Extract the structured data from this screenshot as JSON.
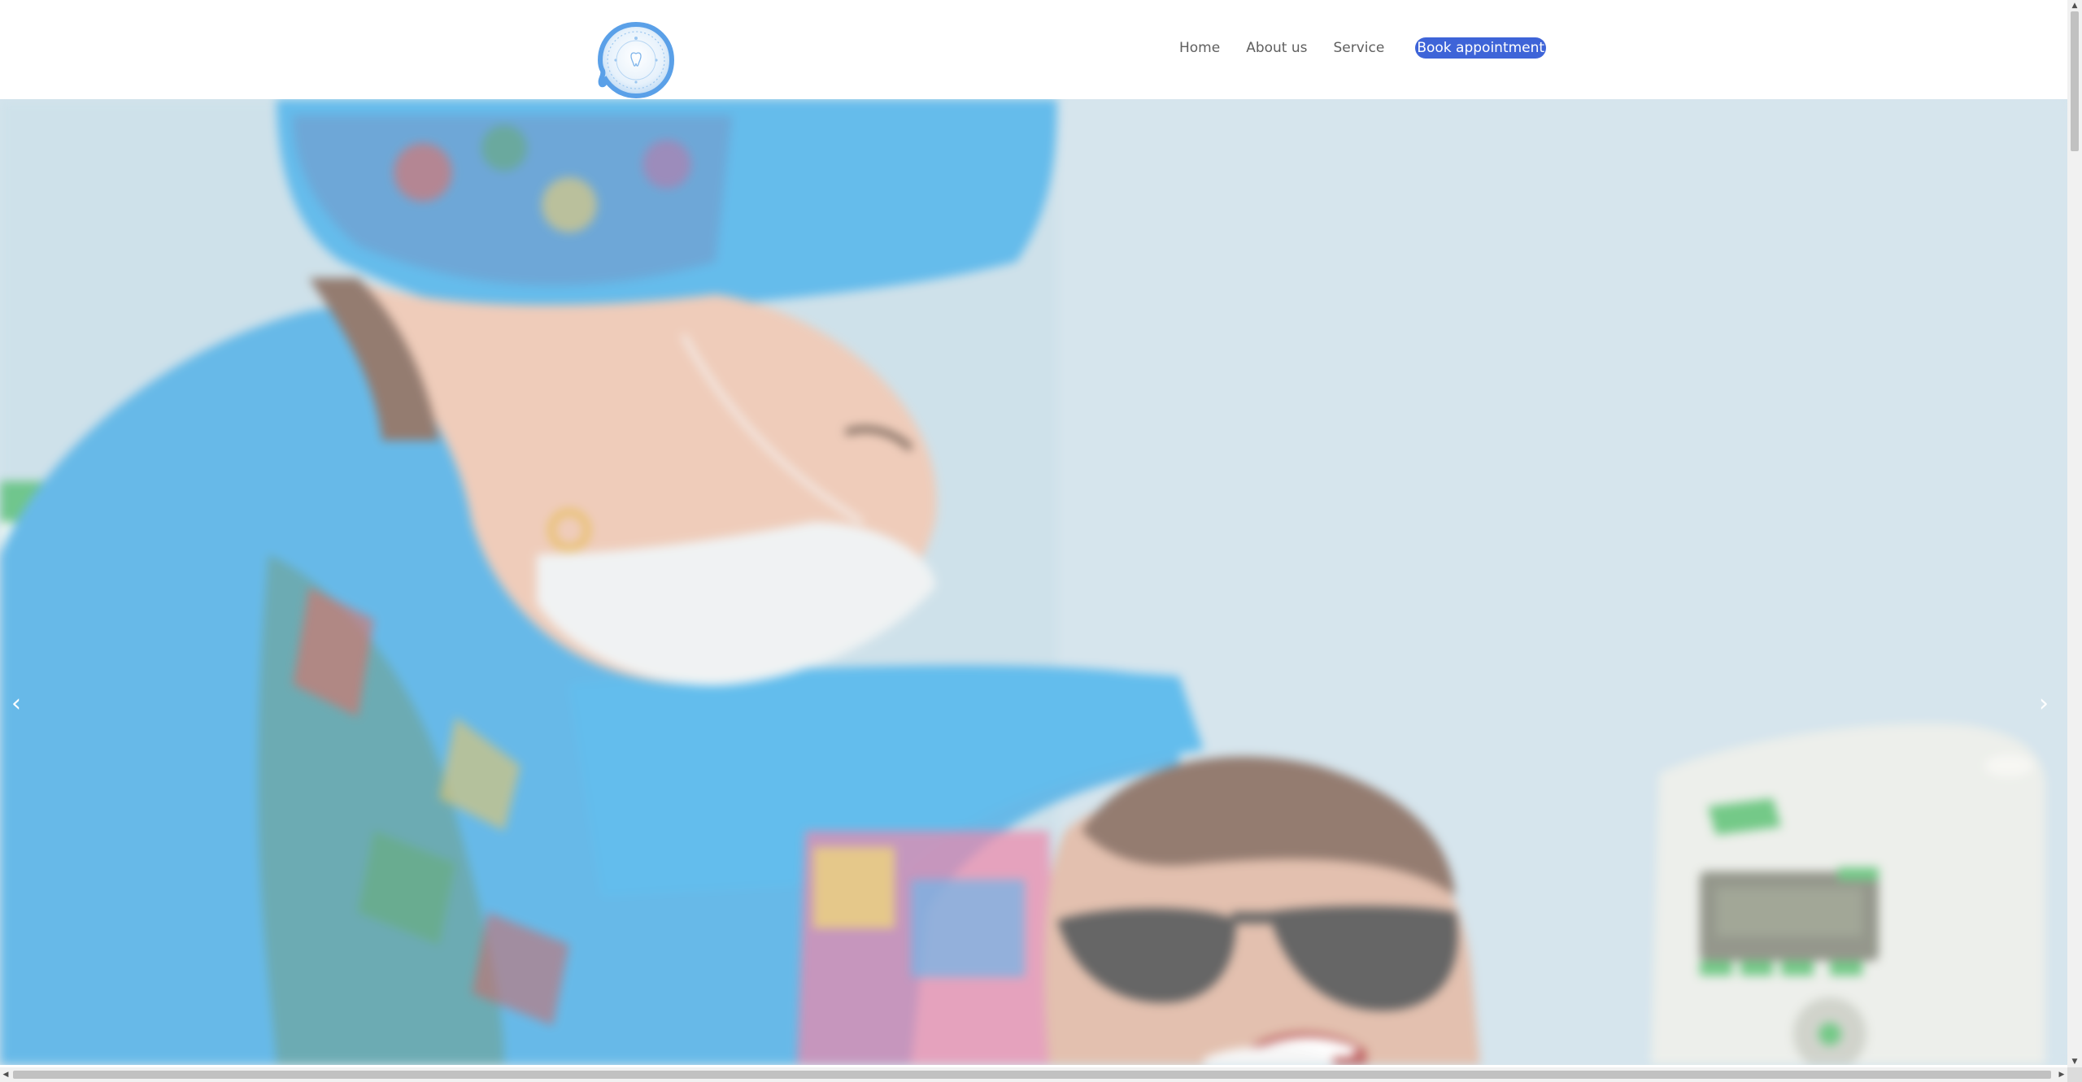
{
  "header": {
    "nav": [
      {
        "label": "Home"
      },
      {
        "label": "About us"
      },
      {
        "label": "Service"
      }
    ],
    "cta_label": "Book appointment"
  },
  "carousel": {
    "prev_glyph": "‹",
    "next_glyph": "›"
  },
  "scrollbars": {
    "up_glyph": "▲",
    "down_glyph": "▼",
    "left_glyph": "◀",
    "right_glyph": "▶"
  },
  "icons": {
    "logo": "dental-clinic-logo-icon",
    "prev": "chevron-left-icon",
    "next": "chevron-right-icon"
  },
  "colors": {
    "accent": "#3e64d8",
    "logo_blue": "#5aa0e8",
    "nav_text": "#5f5f5f"
  }
}
